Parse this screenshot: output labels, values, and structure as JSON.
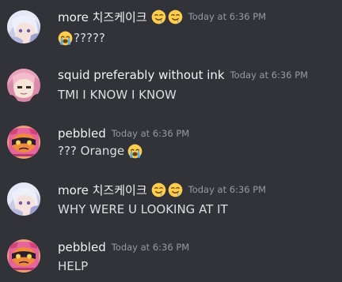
{
  "messages": [
    {
      "username": "more 치즈케이크",
      "name_emojis": [
        "drooling-face",
        "drooling-face"
      ],
      "timestamp": "Today at 6:36 PM",
      "content_prefix_emoji": "loudly-crying-face",
      "content": "?????",
      "avatar": "white-haired-anime-avatar"
    },
    {
      "username": "squid preferably without ink",
      "timestamp": "Today at 6:36 PM",
      "content": "TMI I KNOW I KNOW",
      "avatar": "pink-haired-anime-avatar"
    },
    {
      "username": "pebbled",
      "timestamp": "Today at 6:36 PM",
      "content": "??? Orange",
      "content_suffix_emoji": "loudly-crying-face",
      "avatar": "inkling-orange-avatar"
    },
    {
      "username": "more 치즈케이크",
      "name_emojis": [
        "drooling-face",
        "drooling-face"
      ],
      "timestamp": "Today at 6:36 PM",
      "content": "WHY WERE U LOOKING AT IT",
      "avatar": "white-haired-anime-avatar"
    },
    {
      "username": "pebbled",
      "timestamp": "Today at 6:36 PM",
      "content": "HELP",
      "avatar": "inkling-orange-avatar"
    }
  ],
  "colors": {
    "background": "#313338",
    "username": "#f2f3f5",
    "text": "#dbdee1",
    "timestamp": "#949ba4"
  }
}
